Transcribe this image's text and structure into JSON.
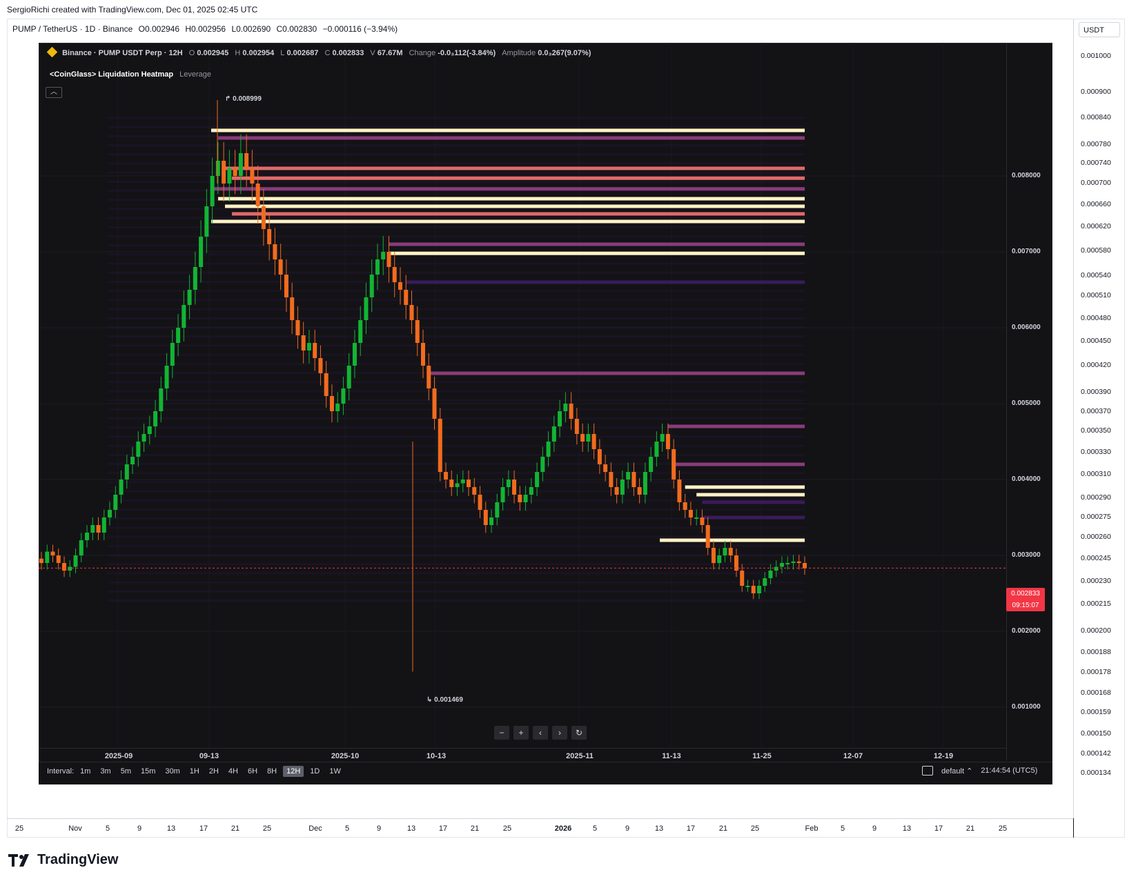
{
  "credit": "SergioRichi created with TradingView.com, Dec 01, 2025 02:45 UTC",
  "symbol_line": {
    "symbol": "PUMP / TetherUS · 1D · Binance",
    "open": "O0.002946",
    "high": "H0.002956",
    "low": "L0.002690",
    "close": "C0.002830",
    "change": "−0.000116 (−3.94%)"
  },
  "currency": "USDT",
  "outer_price_ticks": [
    "0.001000",
    "0.000900",
    "0.000840",
    "0.000780",
    "0.000740",
    "0.000700",
    "0.000660",
    "0.000620",
    "0.000580",
    "0.000540",
    "0.000510",
    "0.000480",
    "0.000450",
    "0.000420",
    "0.000390",
    "0.000370",
    "0.000350",
    "0.000330",
    "0.000310",
    "0.000290",
    "0.000275",
    "0.000260",
    "0.000245",
    "0.000230",
    "0.000215",
    "0.000200",
    "0.000188",
    "0.000178",
    "0.000168",
    "0.000159",
    "0.000150",
    "0.000142",
    "0.000134"
  ],
  "outer_time_ticks": [
    {
      "label": "25",
      "bold": false
    },
    {
      "label": "Nov",
      "bold": false
    },
    {
      "label": "5",
      "bold": false
    },
    {
      "label": "9",
      "bold": false
    },
    {
      "label": "13",
      "bold": false
    },
    {
      "label": "17",
      "bold": false
    },
    {
      "label": "21",
      "bold": false
    },
    {
      "label": "25",
      "bold": false
    },
    {
      "label": "Dec",
      "bold": false
    },
    {
      "label": "5",
      "bold": false
    },
    {
      "label": "9",
      "bold": false
    },
    {
      "label": "13",
      "bold": false
    },
    {
      "label": "17",
      "bold": false
    },
    {
      "label": "21",
      "bold": false
    },
    {
      "label": "25",
      "bold": false
    },
    {
      "label": "2026",
      "bold": true
    },
    {
      "label": "5",
      "bold": false
    },
    {
      "label": "9",
      "bold": false
    },
    {
      "label": "13",
      "bold": false
    },
    {
      "label": "17",
      "bold": false
    },
    {
      "label": "21",
      "bold": false
    },
    {
      "label": "25",
      "bold": false
    },
    {
      "label": "Feb",
      "bold": false
    },
    {
      "label": "5",
      "bold": false
    },
    {
      "label": "9",
      "bold": false
    },
    {
      "label": "13",
      "bold": false
    },
    {
      "label": "17",
      "bold": false
    },
    {
      "label": "21",
      "bold": false
    },
    {
      "label": "25",
      "bold": false
    }
  ],
  "logo_text": "TradingView",
  "inner": {
    "exchange_title": "Binance · PUMP USDT Perp · 12H",
    "o_label": "O",
    "o_value": "0.002945",
    "h_label": "H",
    "h_value": "0.002954",
    "l_label": "L",
    "l_value": "0.002687",
    "c_label": "C",
    "c_value": "0.002833",
    "v_label": "V",
    "v_value": "67.67M",
    "change_label": "Change",
    "change_value": "-0.0₃112(-3.84%)",
    "amplitude_label": "Amplitude",
    "amplitude_value": "0.0₃267(9.07%)",
    "indicator": "<CoinGlass> Liquidation Heatmap",
    "indicator_sub": "Leverage",
    "high_marker": "0.008999",
    "low_marker": "0.001469",
    "current_price": "0.002833",
    "countdown": "09:15:07",
    "time_ticks": [
      "2025-09",
      "09-13",
      "2025-10",
      "10-13",
      "2025-11",
      "11-13",
      "11-25",
      "12-07",
      "12-19"
    ],
    "interval_label": "Interval:",
    "intervals": [
      "1m",
      "3m",
      "5m",
      "15m",
      "30m",
      "1H",
      "2H",
      "4H",
      "6H",
      "8H",
      "12H",
      "1D",
      "1W"
    ],
    "active_interval": "12H",
    "layout_name": "default",
    "clock": "21:44:54 (UTC5)"
  },
  "colors": {
    "up": "#12b533",
    "down": "#f26b1d",
    "heat_low": "#3b1a5c",
    "heat_mid": "#8a3b7a",
    "heat_high": "#e06a6a",
    "heat_peak": "#fff3c4",
    "current_price": "#f23645"
  },
  "chart_data": {
    "type": "candlestick_heatmap",
    "title": "Binance · PUMP USDT Perp · 12H",
    "ylabel": "USDT",
    "ylim": [
      0.0009,
      0.0093
    ],
    "y_ticks": [
      0.001,
      0.002,
      0.003,
      0.004,
      0.005,
      0.006,
      0.007,
      0.008
    ],
    "close_path": [
      0.0029,
      0.00305,
      0.003,
      0.0029,
      0.0028,
      0.00285,
      0.003,
      0.0032,
      0.0033,
      0.0034,
      0.0033,
      0.0035,
      0.0036,
      0.0038,
      0.004,
      0.0042,
      0.0043,
      0.0045,
      0.0046,
      0.0047,
      0.0049,
      0.0052,
      0.0055,
      0.0058,
      0.006,
      0.0063,
      0.0065,
      0.0068,
      0.0072,
      0.0076,
      0.008,
      0.0082,
      0.0079,
      0.0081,
      0.008,
      0.0083,
      0.0081,
      0.0079,
      0.0076,
      0.0073,
      0.0071,
      0.0069,
      0.0067,
      0.0064,
      0.0061,
      0.0059,
      0.0057,
      0.0058,
      0.0056,
      0.0054,
      0.0051,
      0.0049,
      0.005,
      0.0052,
      0.0055,
      0.0058,
      0.0061,
      0.0064,
      0.0067,
      0.0069,
      0.007,
      0.0068,
      0.0066,
      0.0065,
      0.0063,
      0.0061,
      0.0058,
      0.0055,
      0.0052,
      0.0048,
      0.0041,
      0.004,
      0.0039,
      0.00395,
      0.004,
      0.0039,
      0.0038,
      0.0036,
      0.0034,
      0.0035,
      0.0037,
      0.0039,
      0.004,
      0.0038,
      0.0037,
      0.0038,
      0.0039,
      0.0041,
      0.0043,
      0.0045,
      0.0047,
      0.0049,
      0.005,
      0.0048,
      0.0046,
      0.0045,
      0.0046,
      0.0044,
      0.0042,
      0.0041,
      0.0039,
      0.0038,
      0.004,
      0.0041,
      0.0039,
      0.0038,
      0.0041,
      0.0043,
      0.0045,
      0.0046,
      0.0044,
      0.004,
      0.0037,
      0.0036,
      0.0035,
      0.0035,
      0.0034,
      0.0031,
      0.0029,
      0.003,
      0.0031,
      0.003,
      0.0028,
      0.0026,
      0.0026,
      0.0025,
      0.0026,
      0.0027,
      0.0028,
      0.00285,
      0.0029,
      0.0029,
      0.00292,
      0.0029,
      0.00283
    ],
    "wick_high": 0.008999,
    "wick_low": 0.001469,
    "liquidation_levels": [
      {
        "price": 0.0086,
        "intensity": 1.0
      },
      {
        "price": 0.0085,
        "intensity": 0.6
      },
      {
        "price": 0.0081,
        "intensity": 0.7
      },
      {
        "price": 0.00797,
        "intensity": 0.75
      },
      {
        "price": 0.00783,
        "intensity": 0.6
      },
      {
        "price": 0.0077,
        "intensity": 0.95
      },
      {
        "price": 0.0076,
        "intensity": 1.0
      },
      {
        "price": 0.0075,
        "intensity": 0.8
      },
      {
        "price": 0.0074,
        "intensity": 1.0
      },
      {
        "price": 0.0071,
        "intensity": 0.5
      },
      {
        "price": 0.00698,
        "intensity": 1.0
      },
      {
        "price": 0.0066,
        "intensity": 0.45
      },
      {
        "price": 0.0054,
        "intensity": 0.5
      },
      {
        "price": 0.0047,
        "intensity": 0.55
      },
      {
        "price": 0.0042,
        "intensity": 0.65
      },
      {
        "price": 0.0039,
        "intensity": 0.95
      },
      {
        "price": 0.0038,
        "intensity": 0.95
      },
      {
        "price": 0.0037,
        "intensity": 0.4
      },
      {
        "price": 0.0035,
        "intensity": 0.35
      },
      {
        "price": 0.0032,
        "intensity": 1.0
      }
    ]
  }
}
